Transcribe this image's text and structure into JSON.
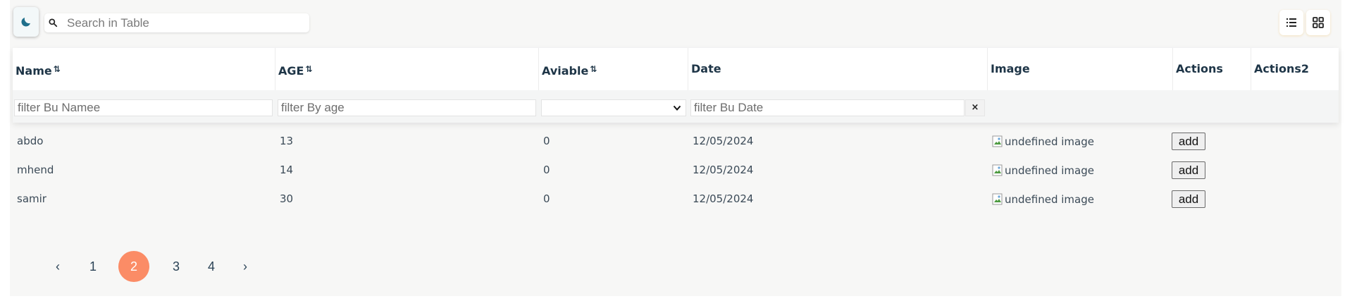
{
  "toolbar": {
    "theme_icon": "moon-icon",
    "search": {
      "placeholder": "Search in Table",
      "value": ""
    },
    "view_buttons": [
      "list-view-icon",
      "grid-view-icon"
    ]
  },
  "table": {
    "columns": [
      {
        "label": "Name",
        "sortable": true
      },
      {
        "label": "AGE",
        "sortable": true
      },
      {
        "label": "Aviable",
        "sortable": true
      },
      {
        "label": "Date",
        "sortable": false
      },
      {
        "label": "Image",
        "sortable": false
      },
      {
        "label": "Actions",
        "sortable": false
      },
      {
        "label": "Actions2",
        "sortable": false
      }
    ],
    "sort_icon": "⇅",
    "filters": {
      "name_placeholder": "filter Bu Namee",
      "age_placeholder": "filter By age",
      "aviable_selected": "",
      "date_placeholder": "filter Bu Date",
      "clear_label": "×"
    },
    "rows": [
      {
        "name": "abdo",
        "age": "13",
        "aviable": "0",
        "date": "12/05/2024",
        "image_alt": "undefined image",
        "action": "add"
      },
      {
        "name": "mhend",
        "age": "14",
        "aviable": "0",
        "date": "12/05/2024",
        "image_alt": "undefined image",
        "action": "add"
      },
      {
        "name": "samir",
        "age": "30",
        "aviable": "0",
        "date": "12/05/2024",
        "image_alt": "undefined image",
        "action": "add"
      }
    ]
  },
  "pagination": {
    "prev": "‹",
    "next": "›",
    "pages": [
      "1",
      "2",
      "3",
      "4"
    ],
    "current": "2",
    "active_color": "#fb8c66"
  },
  "colors": {
    "accent": "#1f6f8b",
    "header_text": "#1e3547",
    "panel_bg": "#f7f7f6"
  }
}
